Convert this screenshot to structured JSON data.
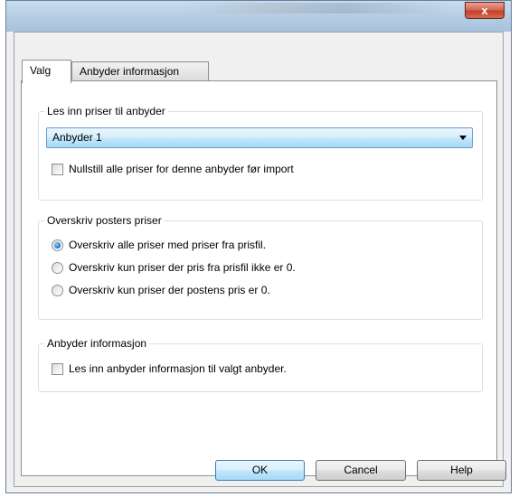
{
  "window": {
    "close_glyph": "x"
  },
  "tabs": [
    {
      "label": "Valg"
    },
    {
      "label": "Anbyder informasjon"
    }
  ],
  "group_prices": {
    "legend": "Les inn priser til anbyder",
    "bidder_select": "Anbyder 1",
    "reset_checkbox": {
      "label": "Nullstill alle priser for denne anbyder før import",
      "checked": false
    }
  },
  "group_overwrite": {
    "legend": "Overskriv posters priser",
    "options": [
      {
        "label": "Overskriv alle priser med priser fra prisfil.",
        "selected": true
      },
      {
        "label": "Overskriv kun priser der pris fra prisfil ikke er 0.",
        "selected": false
      },
      {
        "label": "Overskriv kun priser der postens pris er 0.",
        "selected": false
      }
    ]
  },
  "group_info": {
    "legend": "Anbyder informasjon",
    "read_checkbox": {
      "label": "Les inn anbyder informasjon til valgt anbyder.",
      "checked": false
    }
  },
  "buttons": {
    "ok": "OK",
    "cancel": "Cancel",
    "help": "Help"
  }
}
